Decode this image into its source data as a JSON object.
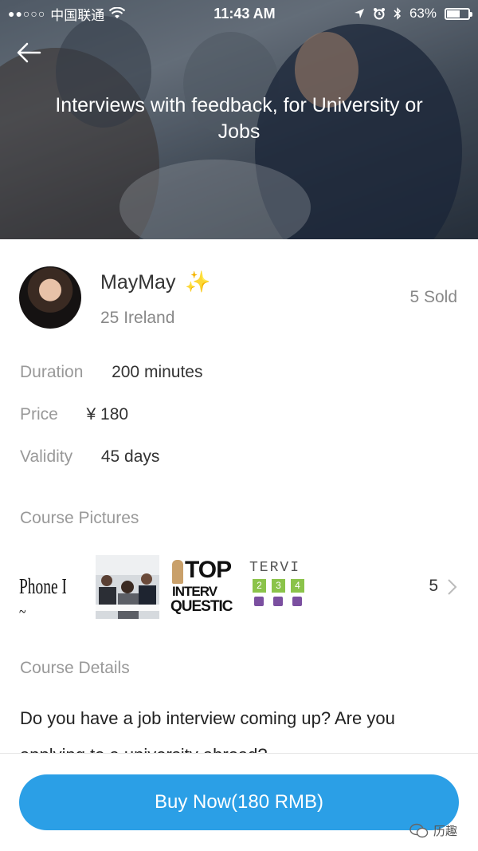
{
  "status_bar": {
    "signal": "●●○○○",
    "carrier": "中国联通",
    "time": "11:43 AM",
    "battery": "63%",
    "battery_level": 0.63
  },
  "header": {
    "title": "Interviews with feedback, for University or Jobs"
  },
  "tutor": {
    "name": "MayMay",
    "name_emoji": "✨",
    "details": "25 Ireland",
    "sold": "5 Sold"
  },
  "info": {
    "duration_label": "Duration",
    "duration_value": "200 minutes",
    "price_label": "Price",
    "price_value": "¥ 180",
    "validity_label": "Validity",
    "validity_value": "45 days"
  },
  "course_pictures": {
    "title": "Course Pictures",
    "thumb1_text": "Phone Int",
    "thumb3_line1": "TOP",
    "thumb3_line2": "INTERV",
    "thumb3_line3": "QUESTIC",
    "thumb4_text": "TERVI",
    "thumb4_steps": [
      "2",
      "3",
      "4"
    ],
    "count": "5"
  },
  "course_details": {
    "title": "Course Details",
    "text": "Do you have a job interview coming up? Are you applying to a university abroad?"
  },
  "footer": {
    "buy_label": "Buy Now(180 RMB)",
    "watermark": "历趣"
  },
  "colors": {
    "accent": "#2b9fe6",
    "muted_text": "#999999"
  }
}
